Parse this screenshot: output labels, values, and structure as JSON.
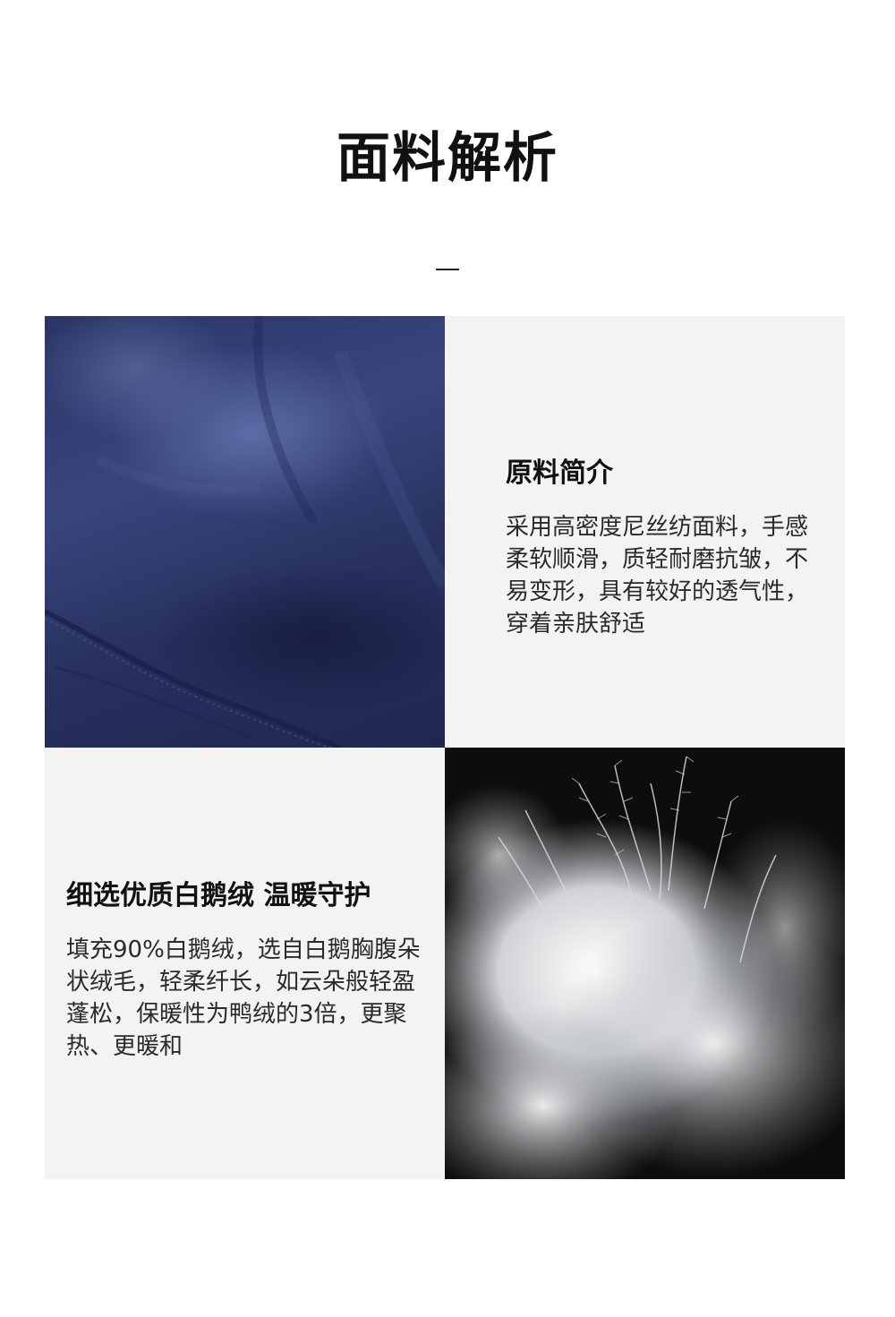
{
  "page": {
    "title": "面料解析"
  },
  "sections": [
    {
      "heading": "原料简介",
      "body": "采用高密度尼丝纺面料，手感柔软顺滑，质轻耐磨抗皱，不易变形，具有较好的透气性，穿着亲肤舒适",
      "image": "navy-fabric-closeup"
    },
    {
      "heading": "细选优质白鹅绒 温暖守护",
      "body": "填充90%白鹅绒，选自白鹅胸腹朵状绒毛，轻柔纤长，如云朵般轻盈蓬松，保暖性为鸭绒的3倍，更聚热、更暖和",
      "image": "white-goose-down-closeup"
    }
  ],
  "colors": {
    "panel_background": "#f3f3f3",
    "fabric_navy": "#2a3466",
    "feather_background": "#0d0d0d",
    "text_primary": "#111111"
  }
}
